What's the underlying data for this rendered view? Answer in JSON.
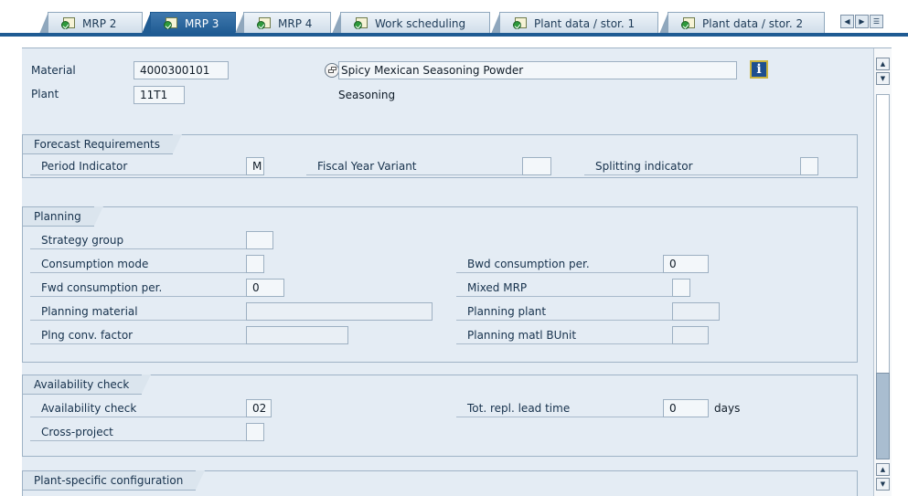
{
  "tabs": [
    {
      "label": "MRP 2",
      "active": false
    },
    {
      "label": "MRP 3",
      "active": true
    },
    {
      "label": "MRP 4",
      "active": false
    },
    {
      "label": "Work scheduling",
      "active": false
    },
    {
      "label": "Plant data / stor. 1",
      "active": false
    },
    {
      "label": "Plant data / stor. 2",
      "active": false
    }
  ],
  "header": {
    "material_label": "Material",
    "material_value": "4000300101",
    "material_desc": "Spicy Mexican Seasoning Powder",
    "plant_label": "Plant",
    "plant_value": "11T1",
    "plant_desc": "Seasoning",
    "info_icon": "i"
  },
  "forecast": {
    "title": "Forecast Requirements",
    "period_indicator_label": "Period Indicator",
    "period_indicator_value": "M",
    "fiscal_year_label": "Fiscal Year Variant",
    "fiscal_year_value": "",
    "splitting_label": "Splitting indicator",
    "splitting_value": ""
  },
  "planning": {
    "title": "Planning",
    "strategy_group_label": "Strategy group",
    "strategy_group_value": "",
    "consumption_mode_label": "Consumption mode",
    "consumption_mode_value": "",
    "fwd_consumption_label": "Fwd consumption per.",
    "fwd_consumption_value": "0",
    "planning_material_label": "Planning material",
    "planning_material_value": "",
    "plng_conv_factor_label": "Plng conv. factor",
    "plng_conv_factor_value": "",
    "bwd_consumption_label": "Bwd consumption per.",
    "bwd_consumption_value": "0",
    "mixed_mrp_label": "Mixed MRP",
    "mixed_mrp_value": "",
    "planning_plant_label": "Planning plant",
    "planning_plant_value": "",
    "planning_matl_bunit_label": "Planning matl BUnit",
    "planning_matl_bunit_value": ""
  },
  "availability": {
    "title": "Availability check",
    "availability_check_label": "Availability check",
    "availability_check_value": "02",
    "cross_project_label": "Cross-project",
    "cross_project_value": "",
    "tot_repl_label": "Tot. repl. lead time",
    "tot_repl_value": "0",
    "tot_repl_unit": "days"
  },
  "plant_config": {
    "title": "Plant-specific configuration"
  },
  "colors": {
    "active_tab": "#1f5b93",
    "panel_bg": "#e4ecf4",
    "border": "#9fb3c6"
  }
}
